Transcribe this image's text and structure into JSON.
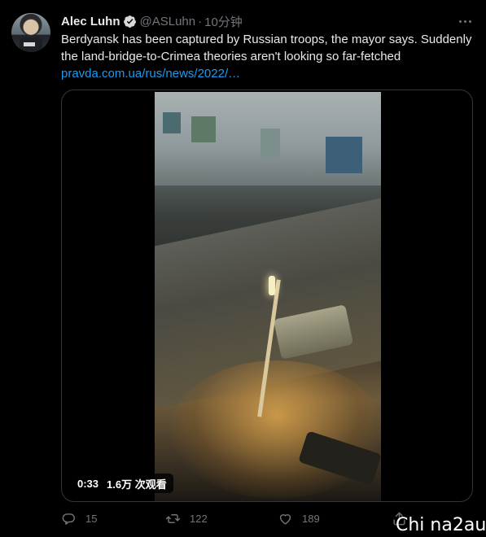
{
  "tweet": {
    "author_name": "Alec Luhn",
    "verified": true,
    "handle": "@ASLuhn",
    "separator": "·",
    "time": "10分钟",
    "text_line1": "Berdyansk has been captured by Russian troops, the mayor says. Suddenly",
    "text_line2": "the land-bridge-to-Crimea theories aren't looking so far-fetched",
    "link_text": "pravda.com.ua/rus/news/2022/…"
  },
  "video": {
    "duration": "0:33",
    "views": "1.6万 次观看"
  },
  "actions": {
    "replies": "15",
    "retweets": "122",
    "likes": "189"
  },
  "watermark": "Chi na2au",
  "icons": {
    "verified": "verified-badge-icon",
    "more": "more-dots-icon",
    "reply": "reply-icon",
    "retweet": "retweet-icon",
    "like": "heart-icon",
    "share": "share-icon"
  },
  "colors": {
    "background": "#000000",
    "text": "#e7e9ea",
    "secondary": "#71767b",
    "link": "#1d9bf0"
  }
}
